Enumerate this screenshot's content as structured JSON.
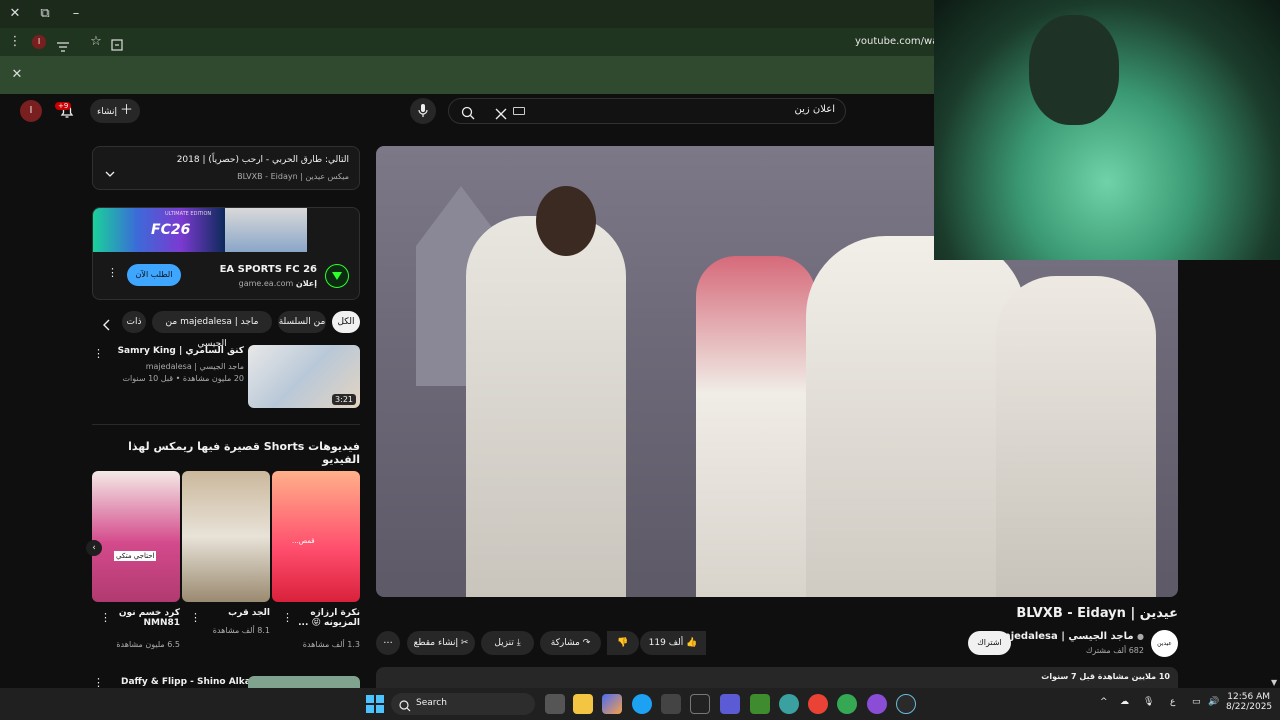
{
  "browser": {
    "url": "youtube.com/watch",
    "close_symbol": "✕",
    "tab_symbol": "⧉",
    "minimize_symbol": "–",
    "menu_symbol": "⋮",
    "profile_initial": "I",
    "star_symbol": "☆"
  },
  "infobar": {
    "close_symbol": "✕"
  },
  "header": {
    "search_value": "اعلان زين",
    "create_label": "إنشاء",
    "notif_badge": "+9",
    "avatar_initial": "I"
  },
  "up_next": {
    "title": "التالي: طارق الحربي - ارحب (حصرياً) | 2018",
    "subtitle": "ميكس عيدين | BLVXB - Eidayn"
  },
  "ad": {
    "title": "EA SPORTS FC 26",
    "badge": "إعلان",
    "domain": "game.ea.com",
    "cta": "الطلب الآن",
    "banner_text": "FC26",
    "banner_edition": "ULTIMATE EDITION"
  },
  "chips": [
    "الكل",
    "من السلسلة",
    "من majedalesa | ماجد الجيسي",
    "ذات صلة"
  ],
  "related": {
    "title": "كنق السامري | Samry King",
    "channel": "ماجد الجيسي | majedalesa",
    "meta": "20 مليون مشاهدة • قبل 10 سنوات",
    "duration": "3:21"
  },
  "shorts": {
    "heading": "فيديوهات Shorts قصيرة فيها ريمكس لهذا الفيديو",
    "items": [
      {
        "title": "نكرة ارزازه المزيونه 😝 ...",
        "views": "1.3 ألف مشاهدة"
      },
      {
        "title": "الجد قرب",
        "views": "8.1 ألف مشاهدة"
      },
      {
        "title": "كرد خسم نون NMN81",
        "views": "6.5 مليون مشاهدة"
      }
    ],
    "overlay_1": "...قمص",
    "overlay_2": "احتاجي متكي"
  },
  "next_related": {
    "title": "Daffy & Flipp - Shino Alkalam"
  },
  "video": {
    "title": "عيدين | BLVXB - Eidayn",
    "channel": "ماجد الجيسي | majedalesa",
    "subs": "682 ألف مشترك",
    "subscribe": "اشتراك",
    "likes": "119 ألف",
    "share": "مشاركة",
    "download": "تنزيل",
    "clip": "إنشاء مقطع",
    "more": "...",
    "desc_meta": "10 ملايين مشاهدة قبل 7 سنوات",
    "channel_logo_text": "عيدين"
  },
  "taskbar": {
    "search_label": "Search",
    "time": "12:56 AM",
    "date": "8/22/2025",
    "lang": "ع"
  },
  "colors": {
    "chrome_green": "#2f4a2f",
    "yt_bg": "#0f0f0f",
    "ad_cta": "#3ea6ff"
  }
}
